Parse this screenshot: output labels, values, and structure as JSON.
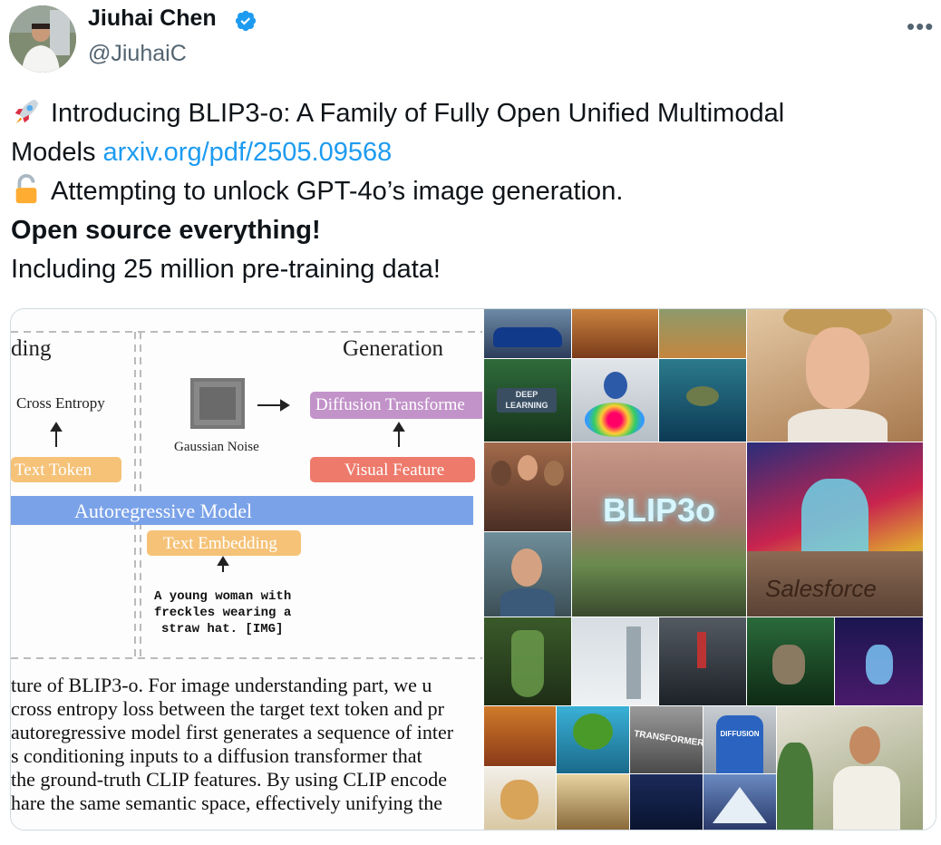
{
  "author": {
    "name": "Jiuhai Chen",
    "handle": "@JiuhaiC",
    "verified": true,
    "avatar_icon": "avatar-photo"
  },
  "more_icon": "more-options-icon",
  "tweet": {
    "line1_text": "Introducing BLIP3-o: A Family of Fully Open Unified Multimodal",
    "line2_text": "Models ",
    "link": "arxiv.org/pdf/2505.09568",
    "line3_text": "Attempting to unlock GPT-4o’s image generation.",
    "line4_bold": "Open source everything!",
    "line5_text": "Including 25 million pre-training data!",
    "emoji_rocket": "rocket-emoji",
    "emoji_lock": "unlocked-lock-emoji"
  },
  "figure": {
    "left_heading": "ding",
    "right_heading": "Generation",
    "cross_entropy": "Cross Entropy",
    "gaussian_noise": "Gaussian Noise",
    "diffusion_transformer": "Diffusion Transforme",
    "text_token": "Text Token",
    "visual_feature": "Visual Feature",
    "autoregressive_model": "Autoregressive Model",
    "text_embedding": "Text Embedding",
    "prompt_line1": "A young woman with",
    "prompt_line2": "freckles wearing a",
    "prompt_line3": "straw hat. [IMG]",
    "caption": [
      "ture of BLIP3-o. For image understanding part, we u",
      " cross entropy loss between the target text token and pr",
      "autoregressive model first generates a sequence of inter",
      "s conditioning inputs to a diffusion transformer that",
      " the ground-truth CLIP features. By using CLIP encode",
      "hare the same semantic space, effectively unifying the"
    ]
  },
  "collage": {
    "tile_deep_learning": "DEEP LEARNING",
    "tile_blip3o": "BLIP3o",
    "tile_salesforce": "Salesforce",
    "tile_transformer": "TRANSFORMER",
    "tile_diffusion": "DIFFUSION"
  },
  "colors": {
    "link": "#1d9bf0",
    "verified": "#1d9bf0",
    "secondary_text": "#536471",
    "box_purple": "#c293c9",
    "box_orange": "#f5c278",
    "box_red": "#ee7a6b",
    "box_blue": "#7aa2e8"
  }
}
